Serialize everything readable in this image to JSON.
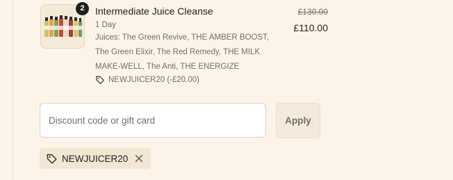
{
  "cart_item": {
    "quantity": "2",
    "name": "Intermediate Juice Cleanse",
    "variant": "1 Day",
    "juices": "Juices: The Green Revive, THE AMBER BOOST, The Green Elixir, The Red Remedy, THE MILK MAKE-WELL, The Anti, THE ENERGIZE",
    "discount_applied": "NEWJUICER20 (-£20.00)",
    "original_price": "£130.00",
    "price": "£110.00"
  },
  "discount_form": {
    "placeholder": "Discount code or gift card",
    "value": "",
    "apply_label": "Apply"
  },
  "applied_codes": [
    {
      "code": "NEWJUICER20"
    }
  ],
  "icons": {
    "tag": "tag-icon",
    "remove": "close-icon"
  }
}
